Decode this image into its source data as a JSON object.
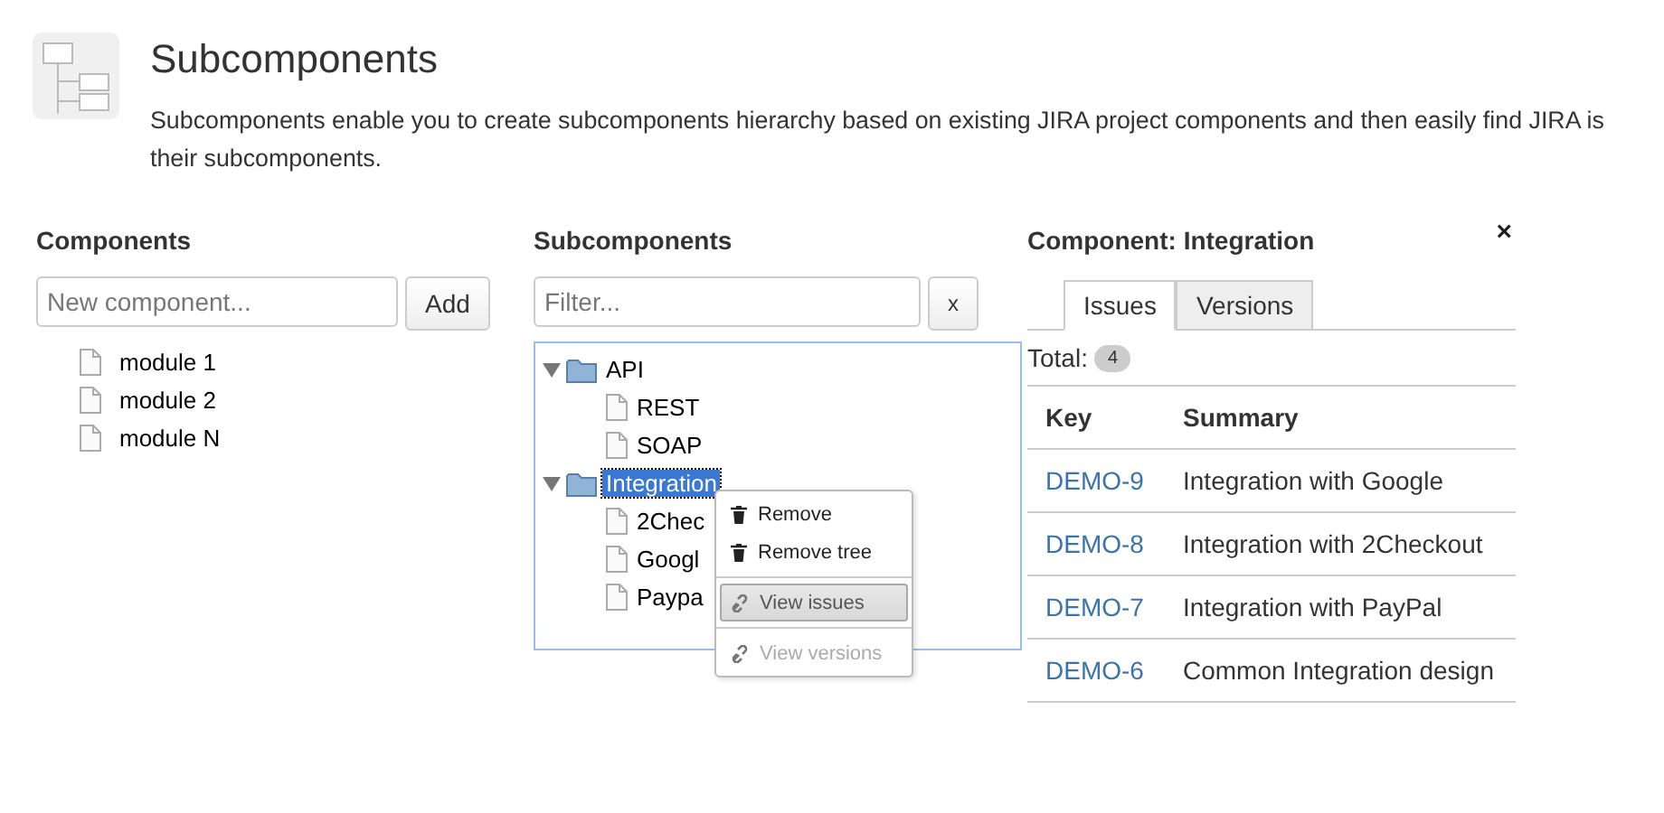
{
  "header": {
    "title": "Subcomponents",
    "description_lines": [
      "Subcomponents enable you to create subcomponents hierarchy based on existing JIRA project components and then easily find JIRA is",
      "their subcomponents."
    ]
  },
  "components": {
    "heading": "Components",
    "input": {
      "placeholder": "New component..."
    },
    "add_button": "Add",
    "items": [
      "module 1",
      "module 2",
      "module N"
    ]
  },
  "subcomponents": {
    "heading": "Subcomponents",
    "filter": {
      "placeholder": "Filter..."
    },
    "clear_button": "x",
    "tree": [
      {
        "label": "API",
        "kind": "folder",
        "expanded": true,
        "selected": false,
        "children": [
          {
            "label": "REST",
            "kind": "file",
            "selected": false
          },
          {
            "label": "SOAP",
            "kind": "file",
            "selected": false
          }
        ]
      },
      {
        "label": "Integration",
        "kind": "folder",
        "expanded": true,
        "selected": true,
        "children": [
          {
            "label": "2Chec",
            "kind": "file",
            "selected": false
          },
          {
            "label": "Googl",
            "kind": "file",
            "selected": false
          },
          {
            "label": "Paypa",
            "kind": "file",
            "selected": false
          }
        ]
      }
    ],
    "context_menu": [
      {
        "label": "Remove",
        "kind": "trash",
        "selected": false,
        "disabled": false,
        "separator_before": false
      },
      {
        "label": "Remove tree",
        "kind": "trash",
        "selected": false,
        "disabled": false,
        "separator_before": false
      },
      {
        "label": "View issues",
        "kind": "link",
        "selected": true,
        "disabled": false,
        "separator_before": true
      },
      {
        "label": "View versions",
        "kind": "link",
        "selected": false,
        "disabled": true,
        "separator_before": true
      }
    ]
  },
  "detail": {
    "heading": "Component: Integration",
    "close": "×",
    "tabs": [
      {
        "label": "Issues",
        "selected": true
      },
      {
        "label": "Versions",
        "selected": false
      }
    ],
    "total_label": "Total:",
    "total_count": "4",
    "columns": [
      "Key",
      "Summary"
    ],
    "rows": [
      {
        "key": "DEMO-9",
        "summary": "Integration with Google"
      },
      {
        "key": "DEMO-8",
        "summary": "Integration with 2Checkout"
      },
      {
        "key": "DEMO-7",
        "summary": "Integration with PayPal"
      },
      {
        "key": "DEMO-6",
        "summary": "Common Integration design"
      }
    ]
  }
}
